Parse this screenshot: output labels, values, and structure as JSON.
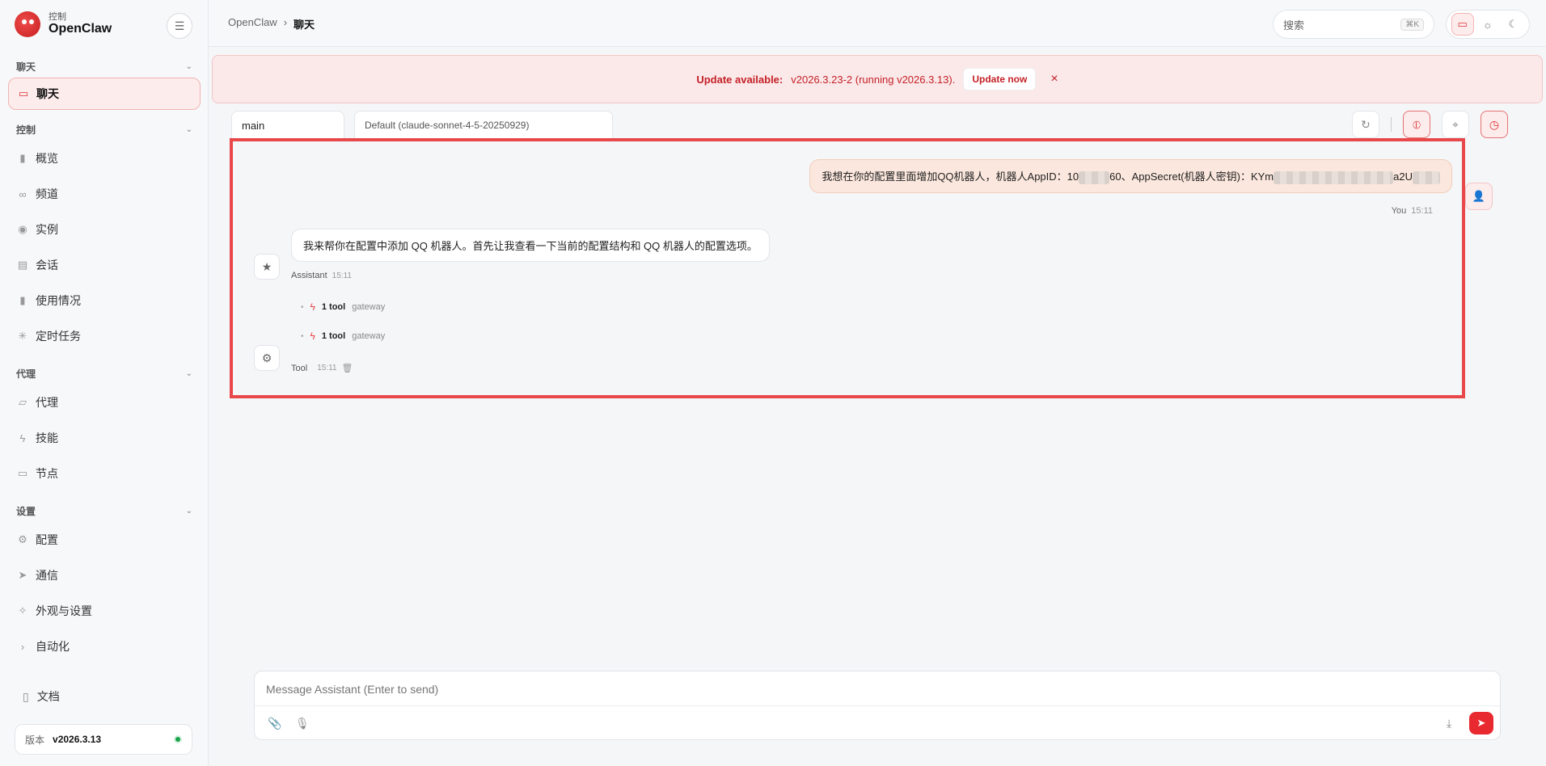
{
  "brand": {
    "sub": "控制",
    "name": "OpenClaw"
  },
  "nav": {
    "sections": [
      {
        "title": "聊天",
        "items": [
          {
            "label": "聊天",
            "icon": "chat-icon",
            "active": true
          }
        ]
      },
      {
        "title": "控制",
        "items": [
          {
            "label": "概览",
            "icon": "bar-chart-icon"
          },
          {
            "label": "频道",
            "icon": "link-icon"
          },
          {
            "label": "实例",
            "icon": "radio-icon"
          },
          {
            "label": "会话",
            "icon": "document-icon"
          },
          {
            "label": "使用情况",
            "icon": "bar-chart-icon"
          },
          {
            "label": "定时任务",
            "icon": "loader-icon"
          }
        ]
      },
      {
        "title": "代理",
        "items": [
          {
            "label": "代理",
            "icon": "folder-icon"
          },
          {
            "label": "技能",
            "icon": "bolt-icon"
          },
          {
            "label": "节点",
            "icon": "monitor-icon"
          }
        ]
      },
      {
        "title": "设置",
        "items": [
          {
            "label": "配置",
            "icon": "gear-icon"
          },
          {
            "label": "通信",
            "icon": "send-icon"
          },
          {
            "label": "外观与设置",
            "icon": "sparkle-icon"
          },
          {
            "label": "自动化",
            "icon": "chevron-right-icon"
          }
        ]
      }
    ],
    "docs_label": "文档",
    "version_label": "版本",
    "version_value": "v2026.3.13"
  },
  "topbar": {
    "breadcrumb_root": "OpenClaw",
    "breadcrumb_sep": "›",
    "breadcrumb_current": "聊天",
    "search_placeholder": "搜索",
    "search_shortcut": "⌘K"
  },
  "banner": {
    "title": "Update available:",
    "detail": "v2026.3.23-2 (running v2026.3.13).",
    "button": "Update now",
    "close": "×"
  },
  "session": {
    "tab": "main",
    "model": "Default (claude-sonnet-4-5-20250929)"
  },
  "messages": {
    "user": {
      "text_a": "我想在你的配置里面增加QQ机器人，机器人AppID：10",
      "text_b": "60、AppSecret(机器人密钥)：KYm",
      "text_c": "a2U",
      "author": "You",
      "time": "15:11"
    },
    "assistant": {
      "text": "我来帮你在配置中添加 QQ 机器人。首先让我查看一下当前的配置结构和 QQ 机器人的配置选项。",
      "author": "Assistant",
      "time": "15:11"
    },
    "tools": [
      {
        "count": "1 tool",
        "name": "gateway"
      },
      {
        "count": "1 tool",
        "name": "gateway"
      }
    ],
    "tool_meta": {
      "author": "Tool",
      "time": "15:11"
    }
  },
  "composer": {
    "placeholder": "Message Assistant (Enter to send)"
  },
  "colors": {
    "accent": "#e8292f",
    "highlight_border": "#e8484a",
    "banner_bg": "#fbe9ea"
  }
}
